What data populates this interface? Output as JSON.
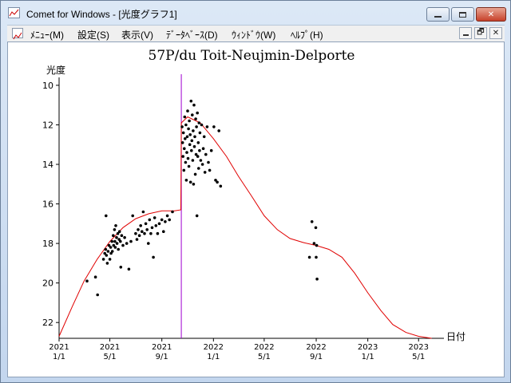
{
  "window": {
    "title": "Comet for Windows - [光度グラフ1]",
    "buttons": [
      "minimize-icon",
      "maximize-icon",
      "close-icon"
    ]
  },
  "menubar": {
    "items": [
      {
        "label": "ﾒﾆｭｰ(M)"
      },
      {
        "label": "設定(S)"
      },
      {
        "label": "表示(V)"
      },
      {
        "label": "ﾃﾞｰﾀﾍﾞｰｽ(D)"
      },
      {
        "label": "ｳｨﾝﾄﾞｳ(W)"
      },
      {
        "label": "ﾍﾙﾌﾟ(H)"
      }
    ],
    "mdi_buttons": [
      "minimize-icon",
      "restore-icon",
      "close-icon"
    ]
  },
  "colors": {
    "curve": "#e00000",
    "perihelion_line": "#a000d0",
    "points": "#000000",
    "axis": "#000000"
  },
  "chart_data": {
    "type": "scatter",
    "title": "57P/du Toit-Neujmin-Delporte",
    "ylabel": "光度",
    "xlabel": "日付",
    "y_inverted": true,
    "ylim": [
      22.8,
      9.6
    ],
    "xlim": [
      "2021-01-01",
      "2023-06-30"
    ],
    "yticks": [
      10,
      12,
      14,
      16,
      18,
      20,
      22
    ],
    "xticks": [
      {
        "date": "2021-01-01",
        "label": [
          "2021",
          "1/1"
        ]
      },
      {
        "date": "2021-05-01",
        "label": [
          "2021",
          "5/1"
        ]
      },
      {
        "date": "2021-09-01",
        "label": [
          "2021",
          "9/1"
        ]
      },
      {
        "date": "2022-01-01",
        "label": [
          "2022",
          "1/1"
        ]
      },
      {
        "date": "2022-05-01",
        "label": [
          "2022",
          "5/1"
        ]
      },
      {
        "date": "2022-09-01",
        "label": [
          "2022",
          "9/1"
        ]
      },
      {
        "date": "2023-01-01",
        "label": [
          "2023",
          "1/1"
        ]
      },
      {
        "date": "2023-05-01",
        "label": [
          "2023",
          "5/1"
        ]
      }
    ],
    "perihelion_date": "2021-10-17",
    "predicted_curve": [
      [
        "2021-01-01",
        22.7
      ],
      [
        "2021-02-01",
        21.2
      ],
      [
        "2021-03-01",
        19.9
      ],
      [
        "2021-04-01",
        18.8
      ],
      [
        "2021-05-01",
        17.9
      ],
      [
        "2021-06-01",
        17.2
      ],
      [
        "2021-07-01",
        16.75
      ],
      [
        "2021-08-01",
        16.5
      ],
      [
        "2021-09-01",
        16.35
      ],
      [
        "2021-10-01",
        16.35
      ],
      [
        "2021-10-16",
        16.3
      ],
      [
        "2021-10-17",
        11.9
      ],
      [
        "2021-11-01",
        11.6
      ],
      [
        "2021-12-01",
        11.9
      ],
      [
        "2022-01-01",
        12.7
      ],
      [
        "2022-02-01",
        13.6
      ],
      [
        "2022-03-01",
        14.6
      ],
      [
        "2022-04-01",
        15.6
      ],
      [
        "2022-05-01",
        16.6
      ],
      [
        "2022-06-01",
        17.3
      ],
      [
        "2022-07-01",
        17.75
      ],
      [
        "2022-08-01",
        17.95
      ],
      [
        "2022-09-01",
        18.1
      ],
      [
        "2022-10-01",
        18.3
      ],
      [
        "2022-11-01",
        18.7
      ],
      [
        "2022-12-01",
        19.5
      ],
      [
        "2023-01-01",
        20.5
      ],
      [
        "2023-02-01",
        21.4
      ],
      [
        "2023-03-01",
        22.1
      ],
      [
        "2023-04-01",
        22.5
      ],
      [
        "2023-05-01",
        22.7
      ],
      [
        "2023-06-01",
        22.8
      ]
    ],
    "observations": [
      [
        "2021-03-08",
        19.9
      ],
      [
        "2021-03-28",
        19.7
      ],
      [
        "2021-04-02",
        20.6
      ],
      [
        "2021-04-22",
        16.6
      ],
      [
        "2021-04-16",
        18.8
      ],
      [
        "2021-04-19",
        18.5
      ],
      [
        "2021-04-21",
        18.3
      ],
      [
        "2021-04-23",
        18.6
      ],
      [
        "2021-04-25",
        19.0
      ],
      [
        "2021-04-27",
        18.4
      ],
      [
        "2021-04-29",
        18.1
      ],
      [
        "2021-05-01",
        18.8
      ],
      [
        "2021-05-03",
        18.2
      ],
      [
        "2021-05-04",
        18.5
      ],
      [
        "2021-05-06",
        17.9
      ],
      [
        "2021-05-07",
        18.4
      ],
      [
        "2021-05-09",
        17.6
      ],
      [
        "2021-05-10",
        18.1
      ],
      [
        "2021-05-12",
        17.3
      ],
      [
        "2021-05-13",
        17.9
      ],
      [
        "2021-05-14",
        18.2
      ],
      [
        "2021-05-15",
        17.1
      ],
      [
        "2021-05-17",
        17.7
      ],
      [
        "2021-05-18",
        18.0
      ],
      [
        "2021-05-20",
        17.5
      ],
      [
        "2021-05-21",
        18.3
      ],
      [
        "2021-05-23",
        17.8
      ],
      [
        "2021-05-24",
        17.4
      ],
      [
        "2021-05-26",
        17.9
      ],
      [
        "2021-05-27",
        19.2
      ],
      [
        "2021-05-29",
        17.6
      ],
      [
        "2021-06-01",
        18.1
      ],
      [
        "2021-06-05",
        17.7
      ],
      [
        "2021-06-10",
        18.0
      ],
      [
        "2021-06-15",
        19.3
      ],
      [
        "2021-06-20",
        17.9
      ],
      [
        "2021-06-24",
        16.6
      ],
      [
        "2021-07-01",
        17.5
      ],
      [
        "2021-07-04",
        17.8
      ],
      [
        "2021-07-07",
        17.3
      ],
      [
        "2021-07-10",
        17.6
      ],
      [
        "2021-07-13",
        17.1
      ],
      [
        "2021-07-16",
        17.4
      ],
      [
        "2021-07-19",
        16.4
      ],
      [
        "2021-07-22",
        17.5
      ],
      [
        "2021-07-25",
        17.0
      ],
      [
        "2021-07-28",
        17.3
      ],
      [
        "2021-07-31",
        18.0
      ],
      [
        "2021-08-03",
        16.8
      ],
      [
        "2021-08-06",
        17.5
      ],
      [
        "2021-08-09",
        17.2
      ],
      [
        "2021-08-12",
        18.7
      ],
      [
        "2021-08-15",
        16.7
      ],
      [
        "2021-08-18",
        17.1
      ],
      [
        "2021-08-22",
        17.5
      ],
      [
        "2021-08-26",
        17.0
      ],
      [
        "2021-09-01",
        16.8
      ],
      [
        "2021-09-05",
        17.4
      ],
      [
        "2021-09-09",
        16.9
      ],
      [
        "2021-09-14",
        16.6
      ],
      [
        "2021-09-19",
        16.8
      ],
      [
        "2021-09-26",
        16.4
      ],
      [
        "2021-10-19",
        12.1
      ],
      [
        "2021-10-20",
        12.9
      ],
      [
        "2021-10-21",
        13.6
      ],
      [
        "2021-10-22",
        12.4
      ],
      [
        "2021-10-23",
        14.3
      ],
      [
        "2021-10-24",
        13.2
      ],
      [
        "2021-10-25",
        11.6
      ],
      [
        "2021-10-26",
        12.7
      ],
      [
        "2021-10-27",
        13.9
      ],
      [
        "2021-10-28",
        12.0
      ],
      [
        "2021-10-29",
        14.8
      ],
      [
        "2021-10-30",
        13.4
      ],
      [
        "2021-10-31",
        12.6
      ],
      [
        "2021-11-01",
        11.3
      ],
      [
        "2021-11-02",
        13.7
      ],
      [
        "2021-11-03",
        12.2
      ],
      [
        "2021-11-04",
        14.1
      ],
      [
        "2021-11-05",
        11.8
      ],
      [
        "2021-11-06",
        13.0
      ],
      [
        "2021-11-07",
        12.5
      ],
      [
        "2021-11-08",
        14.9
      ],
      [
        "2021-11-09",
        10.8
      ],
      [
        "2021-11-10",
        13.3
      ],
      [
        "2021-11-11",
        12.8
      ],
      [
        "2021-11-12",
        11.5
      ],
      [
        "2021-11-13",
        13.8
      ],
      [
        "2021-11-14",
        12.3
      ],
      [
        "2021-11-15",
        15.0
      ],
      [
        "2021-11-16",
        11.0
      ],
      [
        "2021-11-17",
        13.1
      ],
      [
        "2021-11-18",
        12.6
      ],
      [
        "2021-11-19",
        14.5
      ],
      [
        "2021-11-20",
        11.7
      ],
      [
        "2021-11-21",
        13.5
      ],
      [
        "2021-11-22",
        12.1
      ],
      [
        "2021-11-23",
        16.6
      ],
      [
        "2021-11-24",
        11.4
      ],
      [
        "2021-11-25",
        13.6
      ],
      [
        "2021-11-26",
        12.9
      ],
      [
        "2021-11-27",
        14.2
      ],
      [
        "2021-11-28",
        11.9
      ],
      [
        "2021-11-29",
        13.3
      ],
      [
        "2021-11-30",
        12.4
      ],
      [
        "2021-12-02",
        13.8
      ],
      [
        "2021-12-04",
        12.0
      ],
      [
        "2021-12-06",
        14.0
      ],
      [
        "2021-12-08",
        13.2
      ],
      [
        "2021-12-10",
        12.6
      ],
      [
        "2021-12-12",
        14.4
      ],
      [
        "2021-12-14",
        13.5
      ],
      [
        "2021-12-17",
        12.1
      ],
      [
        "2021-12-20",
        13.9
      ],
      [
        "2021-12-23",
        14.3
      ],
      [
        "2021-12-27",
        13.3
      ],
      [
        "2022-01-02",
        12.1
      ],
      [
        "2022-01-06",
        14.8
      ],
      [
        "2022-01-10",
        14.9
      ],
      [
        "2022-01-14",
        12.3
      ],
      [
        "2022-01-18",
        15.1
      ],
      [
        "2022-08-16",
        18.7
      ],
      [
        "2022-08-22",
        16.9
      ],
      [
        "2022-08-27",
        18.0
      ],
      [
        "2022-08-31",
        17.2
      ],
      [
        "2022-09-01",
        18.7
      ],
      [
        "2022-09-02",
        18.1
      ],
      [
        "2022-09-03",
        19.8
      ]
    ]
  }
}
